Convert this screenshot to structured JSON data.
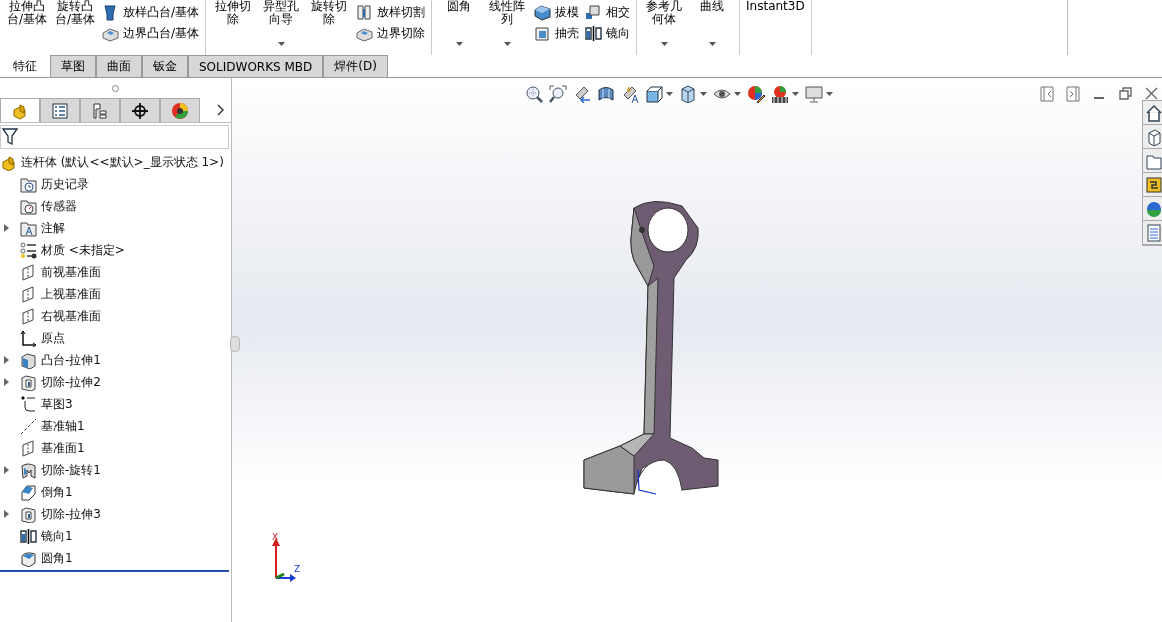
{
  "ribbon": {
    "groups": [
      {
        "large": [
          {
            "label": "拉伸凸台/基体",
            "dropdown": false
          },
          {
            "label": "旋转凸台/基体",
            "dropdown": false
          }
        ],
        "small": [
          {
            "label": "放样凸台/基体",
            "kind": "loft"
          },
          {
            "label": "边界凸台/基体",
            "kind": "boundary"
          }
        ]
      },
      {
        "large": [
          {
            "label": "拉伸切除",
            "dropdown": false
          },
          {
            "label": "异型孔向导",
            "dropdown": true
          },
          {
            "label": "旋转切除",
            "dropdown": false
          }
        ],
        "small": [
          {
            "label": "放样切割",
            "kind": "loftcut"
          },
          {
            "label": "边界切除",
            "kind": "boundary"
          }
        ]
      },
      {
        "large": [
          {
            "label": "圆角",
            "dropdown": true
          },
          {
            "label": "线性阵列",
            "dropdown": true
          }
        ],
        "small": [
          {
            "label": "拔模",
            "kind": "draft"
          },
          {
            "label": "抽壳",
            "kind": "shell"
          },
          {
            "label": "相交",
            "kind": "intersect"
          },
          {
            "label": "镜向",
            "kind": "mirror"
          }
        ]
      },
      {
        "large": [
          {
            "label": "参考几何体",
            "dropdown": true
          },
          {
            "label": "曲线",
            "dropdown": true
          }
        ]
      },
      {
        "large": [
          {
            "label": "Instant3D",
            "dropdown": false
          }
        ]
      }
    ]
  },
  "tabs": [
    {
      "label": "特征",
      "selected": true
    },
    {
      "label": "草图",
      "selected": false
    },
    {
      "label": "曲面",
      "selected": false
    },
    {
      "label": "钣金",
      "selected": false
    },
    {
      "label": "SOLIDWORKS MBD",
      "selected": false
    },
    {
      "label": "焊件(D)",
      "selected": false
    }
  ],
  "panel_tabs": [
    {
      "kind": "part",
      "selected": true
    },
    {
      "kind": "property",
      "selected": false
    },
    {
      "kind": "config",
      "selected": false
    },
    {
      "kind": "dim",
      "selected": false
    },
    {
      "kind": "appearance",
      "selected": false
    }
  ],
  "tree": {
    "label": "连杆体  (默认<<默认>_显示状态 1>)",
    "children": [
      {
        "label": "历史记录",
        "kind": "history",
        "has_children": false
      },
      {
        "label": "传感器",
        "kind": "sensor",
        "has_children": false
      },
      {
        "label": "注解",
        "kind": "annotation",
        "has_children": true
      },
      {
        "label": "材质 <未指定>",
        "kind": "material",
        "has_children": false
      },
      {
        "label": "前视基准面",
        "kind": "plane",
        "has_children": false
      },
      {
        "label": "上视基准面",
        "kind": "plane",
        "has_children": false
      },
      {
        "label": "右视基准面",
        "kind": "plane",
        "has_children": false
      },
      {
        "label": "原点",
        "kind": "origin",
        "has_children": false
      },
      {
        "label": "凸台-拉伸1",
        "kind": "boss",
        "has_children": true
      },
      {
        "label": "切除-拉伸2",
        "kind": "cut",
        "has_children": true
      },
      {
        "label": "草图3",
        "kind": "sketch",
        "has_children": false
      },
      {
        "label": "基准轴1",
        "kind": "axis",
        "has_children": false
      },
      {
        "label": "基准面1",
        "kind": "plane",
        "has_children": false
      },
      {
        "label": "切除-旋转1",
        "kind": "revolve",
        "has_children": true
      },
      {
        "label": "倒角1",
        "kind": "chamfer",
        "has_children": false
      },
      {
        "label": "切除-拉伸3",
        "kind": "cut",
        "has_children": true
      },
      {
        "label": "镜向1",
        "kind": "mirror",
        "has_children": false
      },
      {
        "label": "圆角1",
        "kind": "fillet",
        "has_children": false
      }
    ]
  },
  "triad": {
    "x_label": "X",
    "z_label": "Z"
  }
}
